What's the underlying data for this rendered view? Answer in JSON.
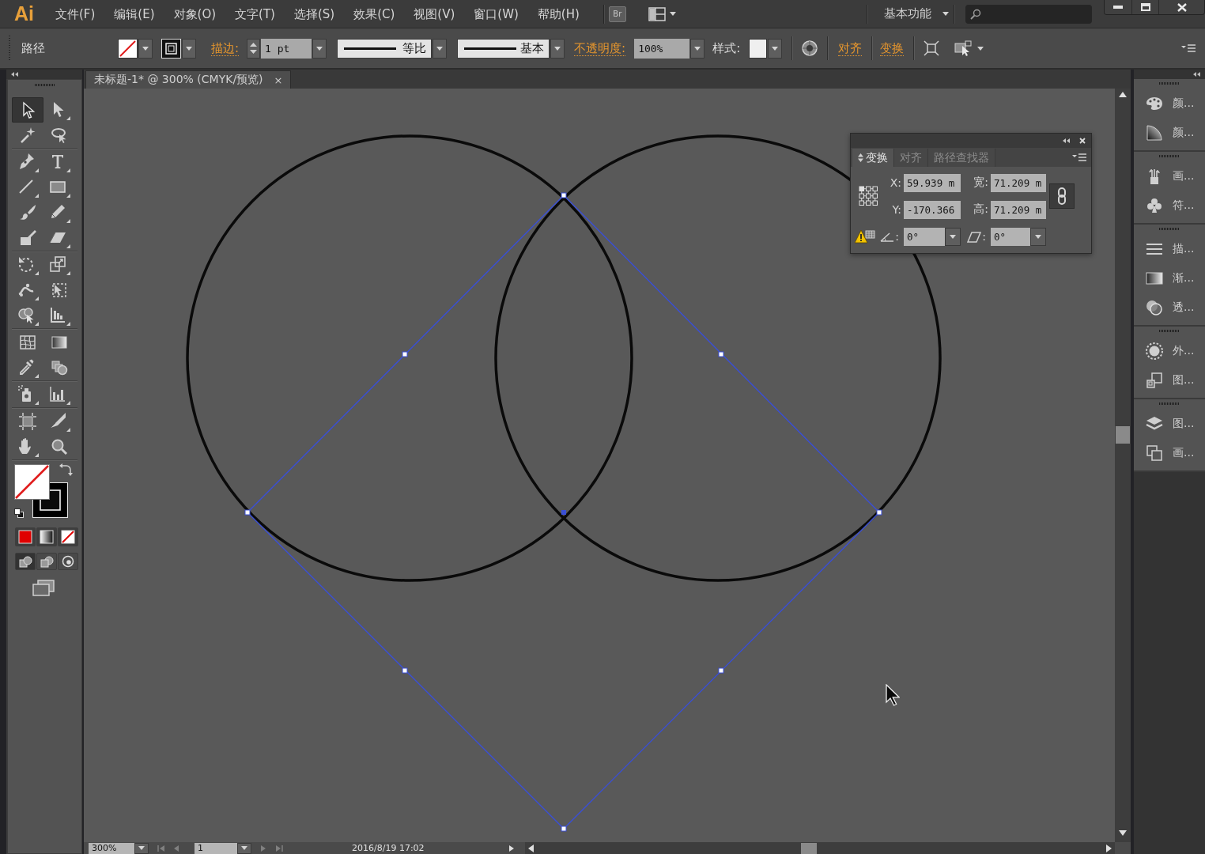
{
  "app": {
    "logo": "Ai",
    "bridge": "Br",
    "workspace": "基本功能"
  },
  "menu_bar": {
    "items": [
      "文件(F)",
      "编辑(E)",
      "对象(O)",
      "文字(T)",
      "选择(S)",
      "效果(C)",
      "视图(V)",
      "窗口(W)",
      "帮助(H)"
    ]
  },
  "control_bar": {
    "selection": "路径",
    "stroke_label": "描边:",
    "stroke_weight": "1 pt",
    "width_profile": "等比",
    "brush": "基本",
    "opacity_label": "不透明度:",
    "opacity": "100%",
    "style_label": "样式:",
    "align_link": "对齐",
    "transform_link": "变换"
  },
  "document_tab": {
    "title": "未标题-1* @ 300% (CMYK/预览)",
    "close": "×"
  },
  "tools": {
    "groups": [
      {
        "tools": [
          {
            "kind": "selection",
            "selected": true
          },
          {
            "kind": "direct_selection",
            "selected": false
          },
          {
            "kind": "magic_wand",
            "selected": false
          },
          {
            "kind": "lasso",
            "selected": false
          }
        ]
      },
      {
        "tools": [
          {
            "kind": "pen",
            "selected": false
          },
          {
            "kind": "type",
            "selected": false
          },
          {
            "kind": "line",
            "selected": false
          },
          {
            "kind": "rectangle",
            "selected": false
          },
          {
            "kind": "paintbrush",
            "selected": false
          },
          {
            "kind": "pencil",
            "selected": false
          },
          {
            "kind": "blob_brush",
            "selected": false
          },
          {
            "kind": "eraser",
            "selected": false
          }
        ]
      },
      {
        "tools": [
          {
            "kind": "rotate",
            "selected": false
          },
          {
            "kind": "scale",
            "selected": false
          },
          {
            "kind": "width",
            "selected": false
          },
          {
            "kind": "free_transform",
            "selected": false
          },
          {
            "kind": "shape_builder",
            "selected": false
          },
          {
            "kind": "perspective_grid",
            "selected": false
          }
        ]
      },
      {
        "tools": [
          {
            "kind": "mesh",
            "selected": false
          },
          {
            "kind": "gradient",
            "selected": false
          },
          {
            "kind": "eyedropper",
            "selected": false
          },
          {
            "kind": "blend",
            "selected": false
          }
        ]
      },
      {
        "tools": [
          {
            "kind": "symbol_sprayer",
            "selected": false
          },
          {
            "kind": "column_graph",
            "selected": false
          }
        ]
      },
      {
        "tools": [
          {
            "kind": "artboard",
            "selected": false
          },
          {
            "kind": "slice",
            "selected": false
          },
          {
            "kind": "hand",
            "selected": false
          },
          {
            "kind": "zoom",
            "selected": false
          }
        ]
      }
    ],
    "color_modes": [
      {
        "kind": "color"
      },
      {
        "kind": "gradient"
      },
      {
        "kind": "none"
      }
    ],
    "draw_modes": [
      {
        "kind": "normal",
        "selected": true
      },
      {
        "kind": "behind",
        "selected": false
      },
      {
        "kind": "inside",
        "selected": false
      }
    ]
  },
  "transform_panel": {
    "tabs": [
      {
        "label": "变换",
        "selected": true
      },
      {
        "label": "对齐",
        "selected": false
      },
      {
        "label": "路径查找器",
        "selected": false
      }
    ],
    "fields": [
      {
        "label": "X:",
        "value": "59.939 m"
      },
      {
        "label": "宽:",
        "value": "71.209 m"
      },
      {
        "label": "Y:",
        "value": "-170.366"
      },
      {
        "label": "高:",
        "value": "71.209 m"
      }
    ],
    "angles": [
      {
        "kind": "rotate",
        "label": ":",
        "value": "0°"
      },
      {
        "kind": "shear",
        "label": ":",
        "value": "0°"
      }
    ]
  },
  "dock": {
    "groups": [
      {
        "items": [
          {
            "kind": "palette",
            "label": "颜..."
          },
          {
            "kind": "color_guide",
            "label": "颜..."
          }
        ]
      },
      {
        "items": [
          {
            "kind": "brushes",
            "label": "画..."
          },
          {
            "kind": "symbols",
            "label": "符..."
          }
        ]
      },
      {
        "items": [
          {
            "kind": "stroke",
            "label": "描..."
          },
          {
            "kind": "gradient",
            "label": "渐..."
          },
          {
            "kind": "transparency",
            "label": "透..."
          }
        ]
      },
      {
        "items": [
          {
            "kind": "appearance",
            "label": "外..."
          },
          {
            "kind": "graphic_styles",
            "label": "图..."
          }
        ]
      },
      {
        "items": [
          {
            "kind": "layers",
            "label": "图..."
          },
          {
            "kind": "artboards",
            "label": "画..."
          }
        ]
      }
    ]
  },
  "status_bar": {
    "zoom": "300%",
    "artboard": "1",
    "info": "2016/8/19 17:02"
  }
}
